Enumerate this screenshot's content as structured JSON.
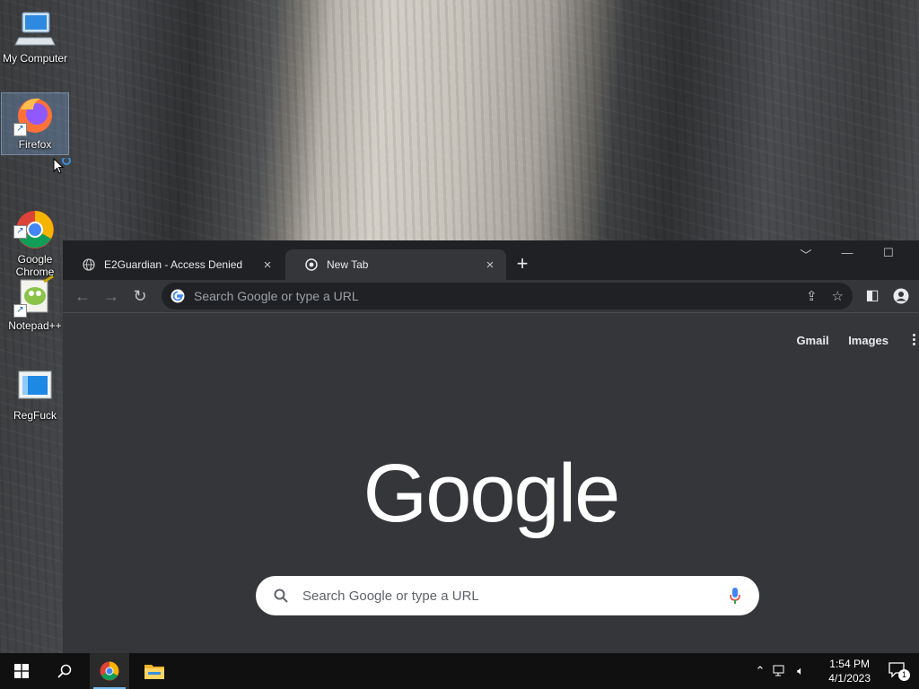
{
  "desktop": {
    "icons": [
      {
        "label": "My Computer"
      },
      {
        "label": "Firefox"
      },
      {
        "label": "Google\nChrome"
      },
      {
        "label": "Notepad++"
      },
      {
        "label": "RegFuck"
      }
    ]
  },
  "browser": {
    "tabs": [
      {
        "title": "E2Guardian - Access Denied",
        "close": "×"
      },
      {
        "title": "New Tab",
        "close": "×"
      }
    ],
    "new_tab": "+",
    "omnibox_placeholder": "Search Google or type a URL",
    "ntp": {
      "gmail": "Gmail",
      "images": "Images",
      "logo": "Google",
      "search_placeholder": "Search Google or type a URL"
    },
    "colors": {
      "tabstrip": "#202124",
      "toolbar": "#35363a",
      "content": "#35363a"
    }
  },
  "taskbar": {
    "time": "1:54 PM",
    "date": "4/1/2023",
    "notification_count": "1"
  }
}
